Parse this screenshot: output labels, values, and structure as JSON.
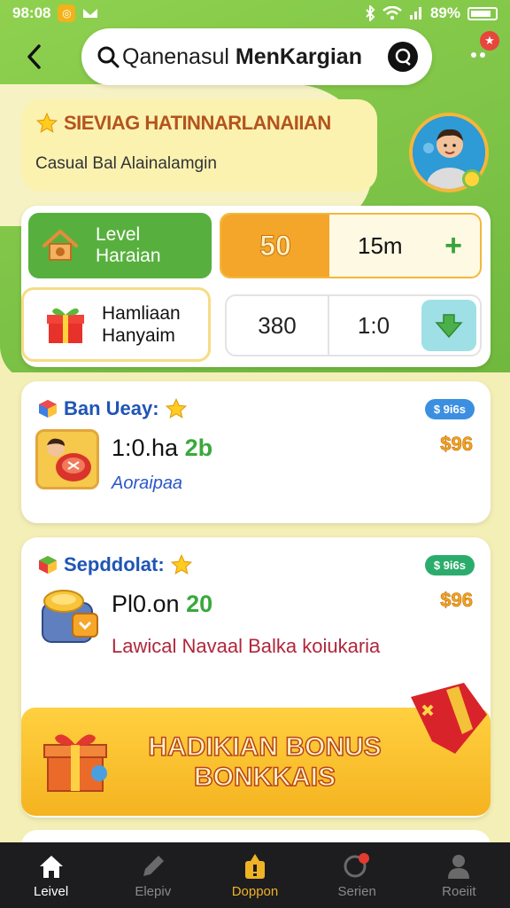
{
  "status_bar": {
    "time": "98:08",
    "battery": "89%"
  },
  "search": {
    "prefix": "Qanenasul",
    "bold": "MenKargian"
  },
  "header": {
    "title": "SIEVIAG HATINNARLANAIIAN",
    "subtitle": "Casual Bal Alainalamgin"
  },
  "level_panel": {
    "level_label_1": "Level",
    "level_label_2": "Haraian",
    "stat_orange": "50",
    "stat_mid": "15m",
    "plus": "+",
    "bonus_label_1": "Hamliaan",
    "bonus_label_2": "Hanyaim",
    "stat2_a": "380",
    "stat2_b": "1:0"
  },
  "cards": [
    {
      "title": "Ban Ueay:",
      "pill": "$ 9i6s",
      "price": "$96",
      "amount_main": "1:0.ha",
      "amount_green": "2b",
      "sub": "Aoraipaa"
    },
    {
      "title": "Sepddolat:",
      "pill": "$ 9i6s",
      "price": "$96",
      "amount_main": "Pl0.on",
      "amount_green": "20",
      "sub": "Lawical Navaal Balka koiukaria"
    }
  ],
  "banner": {
    "line1": "HADIKIAN BONUS",
    "line2": "BONKKAIS"
  },
  "nav": [
    {
      "label": "Leivel",
      "icon": "home-icon",
      "state": "active"
    },
    {
      "label": "Elepiv",
      "icon": "pen-icon",
      "state": "normal"
    },
    {
      "label": "Doppon",
      "icon": "promo-icon",
      "state": "promo"
    },
    {
      "label": "Serien",
      "icon": "search-icon",
      "state": "normal"
    },
    {
      "label": "Roeiit",
      "icon": "profile-icon",
      "state": "normal"
    }
  ],
  "colors": {
    "green": "#7cc246",
    "orange": "#f4a62a",
    "gold": "#f5b320",
    "blue_title": "#1f55b5",
    "nav_bg": "#1d1d1f"
  }
}
